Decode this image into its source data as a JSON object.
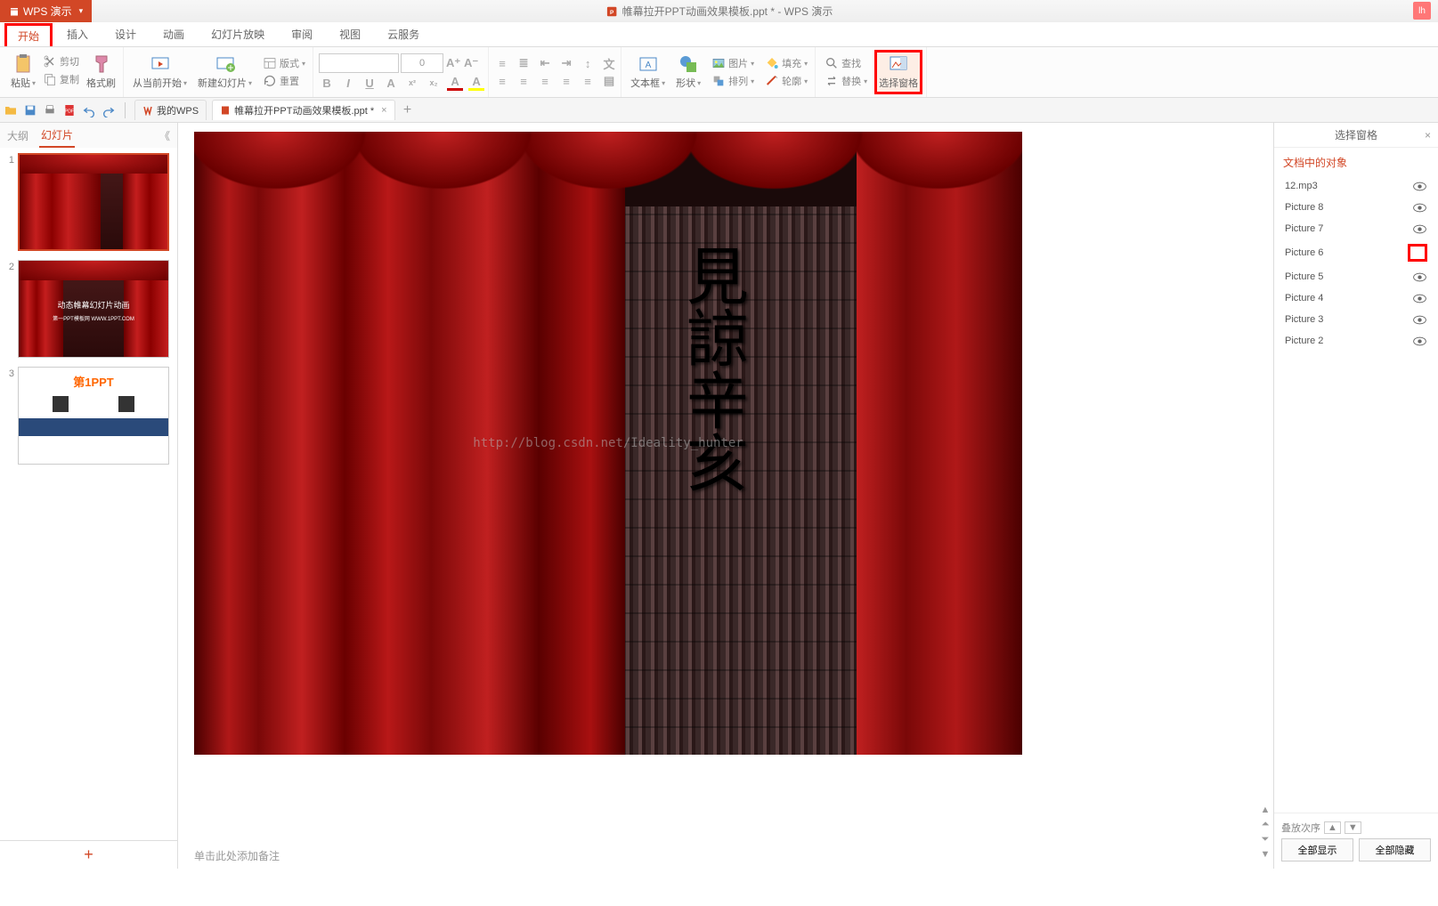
{
  "title_app": "WPS 演示",
  "title_doc": "帷幕拉开PPT动画效果模板.ppt * - WPS 演示",
  "user_badge": "lh",
  "menu": {
    "start": "开始",
    "insert": "插入",
    "design": "设计",
    "anim": "动画",
    "slideshow": "幻灯片放映",
    "review": "审阅",
    "view": "视图",
    "cloud": "云服务"
  },
  "ribbon": {
    "cut": "剪切",
    "copy": "复制",
    "paste": "粘贴",
    "format_painter": "格式刷",
    "from_current": "从当前开始",
    "new_slide": "新建幻灯片",
    "layout": "版式",
    "reset": "重置",
    "font_size": "0",
    "textbox": "文本框",
    "shape": "形状",
    "picture": "图片",
    "fill": "填充",
    "arrange": "排列",
    "outline": "轮廓",
    "find": "查找",
    "replace": "替换",
    "select_pane": "选择窗格"
  },
  "doctabs": {
    "mywps": "我的WPS",
    "file": "帷幕拉开PPT动画效果模板.ppt *"
  },
  "sidetabs": {
    "outline": "大纲",
    "slides": "幻灯片"
  },
  "thumbs": {
    "n1": "1",
    "n2": "2",
    "n3": "3",
    "t2": "动态帷幕幻灯片动画",
    "t2b": "第一PPT模板网 WWW.1PPT.COM",
    "t3": "第1PPT"
  },
  "notes_hint": "单击此处添加备注",
  "watermark": "http://blog.csdn.net/Ideality_hunter",
  "calligraphy": "見諒辛亥",
  "selpane": {
    "title": "选择窗格",
    "subtitle": "文档中的对象",
    "items": [
      {
        "name": "12.mp3",
        "hidden": false
      },
      {
        "name": "Picture 8",
        "hidden": false
      },
      {
        "name": "Picture 7",
        "hidden": false
      },
      {
        "name": "Picture 6",
        "hidden": true
      },
      {
        "name": "Picture 5",
        "hidden": false
      },
      {
        "name": "Picture 4",
        "hidden": false
      },
      {
        "name": "Picture 3",
        "hidden": false
      },
      {
        "name": "Picture 2",
        "hidden": false
      }
    ],
    "stack_label": "叠放次序",
    "show_all": "全部显示",
    "hide_all": "全部隐藏"
  }
}
